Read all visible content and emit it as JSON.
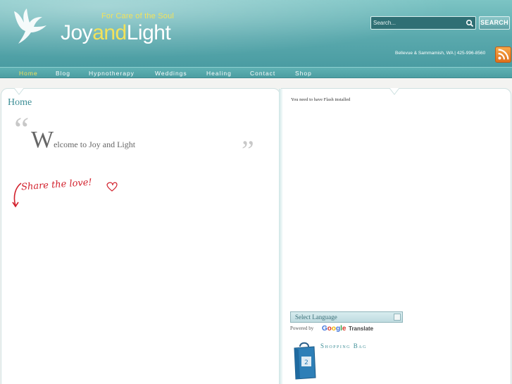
{
  "header": {
    "tagline": "For Care of the Soul",
    "logo": {
      "part1": "Joy",
      "part2": "and",
      "part3": "Light"
    },
    "search_placeholder": "Search...",
    "search_button": "SEARCH",
    "location": "Bellevue & Sammamish, WA | 425-996-8560",
    "colors": {
      "header": "#5aa9ad",
      "accent": "#f3e25a",
      "nav": "#4c9ea2"
    }
  },
  "nav": {
    "items": [
      {
        "label": "Home",
        "active": true
      },
      {
        "label": "Blog",
        "active": false
      },
      {
        "label": "Hypnotherapy",
        "active": false
      },
      {
        "label": "Weddings",
        "active": false
      },
      {
        "label": "Healing",
        "active": false
      },
      {
        "label": "Contact",
        "active": false
      },
      {
        "label": "Shop",
        "active": false
      }
    ]
  },
  "main": {
    "title": "Home",
    "welcome_initial": "W",
    "welcome_rest": "elcome to Joy and Light",
    "share": "Share the love!"
  },
  "sidebar": {
    "flash_message": "You need to have Flash installed",
    "translate_select": "Select Language",
    "powered_by": "Powered by",
    "google": "Google",
    "translate": "Translate",
    "shopping_bag": "Shopping Bag"
  },
  "icons": {
    "logo": "dove-icon",
    "search": "search-icon",
    "rss": "rss-icon",
    "bag": "shopping-bag-icon"
  }
}
